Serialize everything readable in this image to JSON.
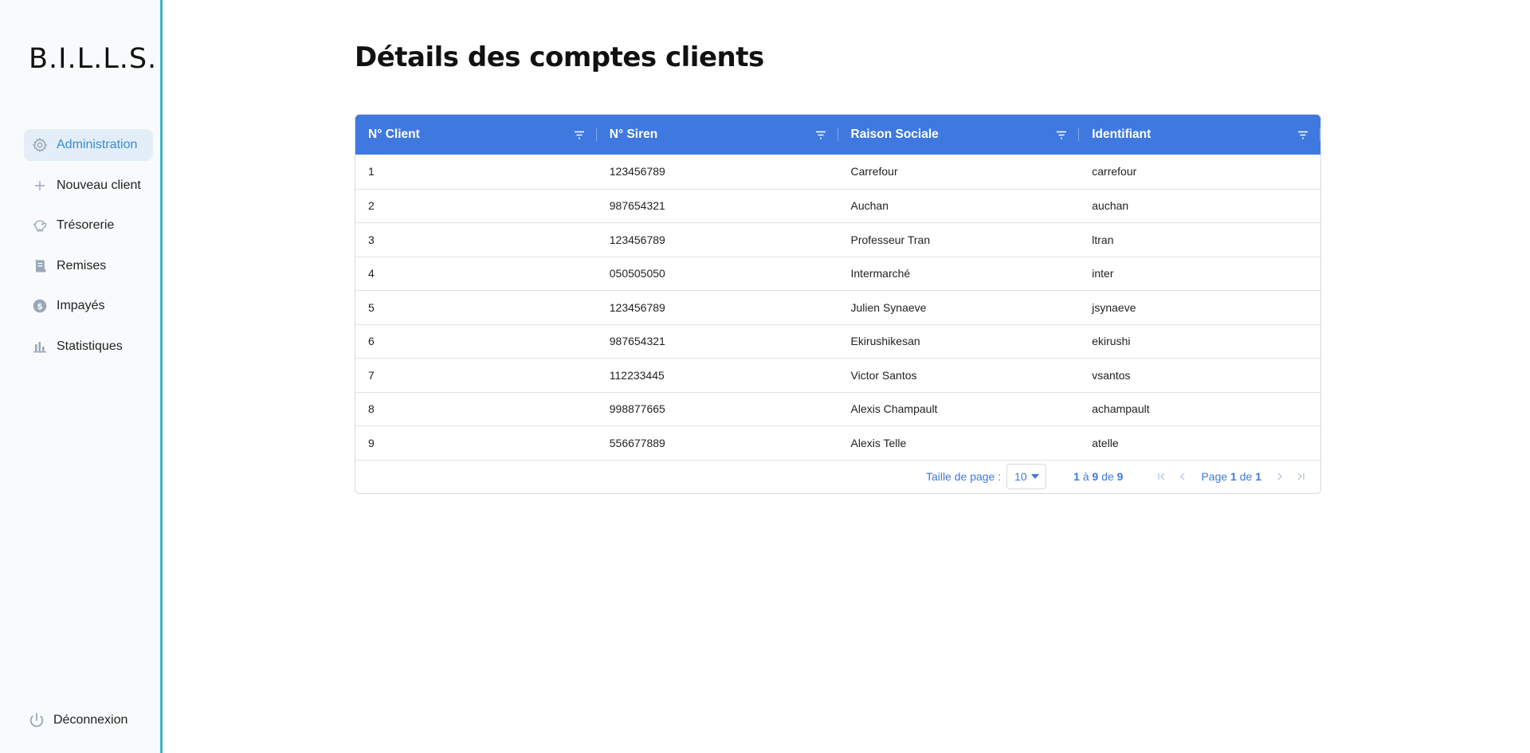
{
  "app": {
    "logo": "B.I.L.L.S."
  },
  "sidebar": {
    "items": [
      {
        "label": "Administration",
        "icon": "gear-icon",
        "active": true
      },
      {
        "label": "Nouveau client",
        "icon": "plus-icon",
        "active": false
      },
      {
        "label": "Trésorerie",
        "icon": "piggy-bank-icon",
        "active": false
      },
      {
        "label": "Remises",
        "icon": "receipt-icon",
        "active": false
      },
      {
        "label": "Impayés",
        "icon": "dollar-circle-icon",
        "active": false
      },
      {
        "label": "Statistiques",
        "icon": "bar-chart-icon",
        "active": false
      }
    ],
    "logout": {
      "label": "Déconnexion",
      "icon": "power-icon"
    }
  },
  "main": {
    "title": "Détails des comptes clients",
    "table": {
      "columns": [
        "N° Client",
        "N° Siren",
        "Raison Sociale",
        "Identifiant"
      ],
      "rows": [
        [
          "1",
          "123456789",
          "Carrefour",
          "carrefour"
        ],
        [
          "2",
          "987654321",
          "Auchan",
          "auchan"
        ],
        [
          "3",
          "123456789",
          "Professeur Tran",
          "ltran"
        ],
        [
          "4",
          "050505050",
          "Intermarché",
          "inter"
        ],
        [
          "5",
          "123456789",
          "Julien Synaeve",
          "jsynaeve"
        ],
        [
          "6",
          "987654321",
          "Ekirushikesan",
          "ekirushi"
        ],
        [
          "7",
          "112233445",
          "Victor Santos",
          "vsantos"
        ],
        [
          "8",
          "998877665",
          "Alexis Champault",
          "achampault"
        ],
        [
          "9",
          "556677889",
          "Alexis Telle",
          "atelle"
        ]
      ]
    },
    "pagination": {
      "page_size_label": "Taille de page :",
      "page_size": "10",
      "range_from": "1",
      "range_sep": "à",
      "range_to": "9",
      "range_of": "de",
      "range_total": "9",
      "page_label": "Page",
      "page_current": "1",
      "page_of": "de",
      "page_total": "1"
    }
  },
  "colors": {
    "accent": "#3f79e0",
    "sidebar_border": "#3bb6c4",
    "active_bg": "#e3eef8"
  }
}
